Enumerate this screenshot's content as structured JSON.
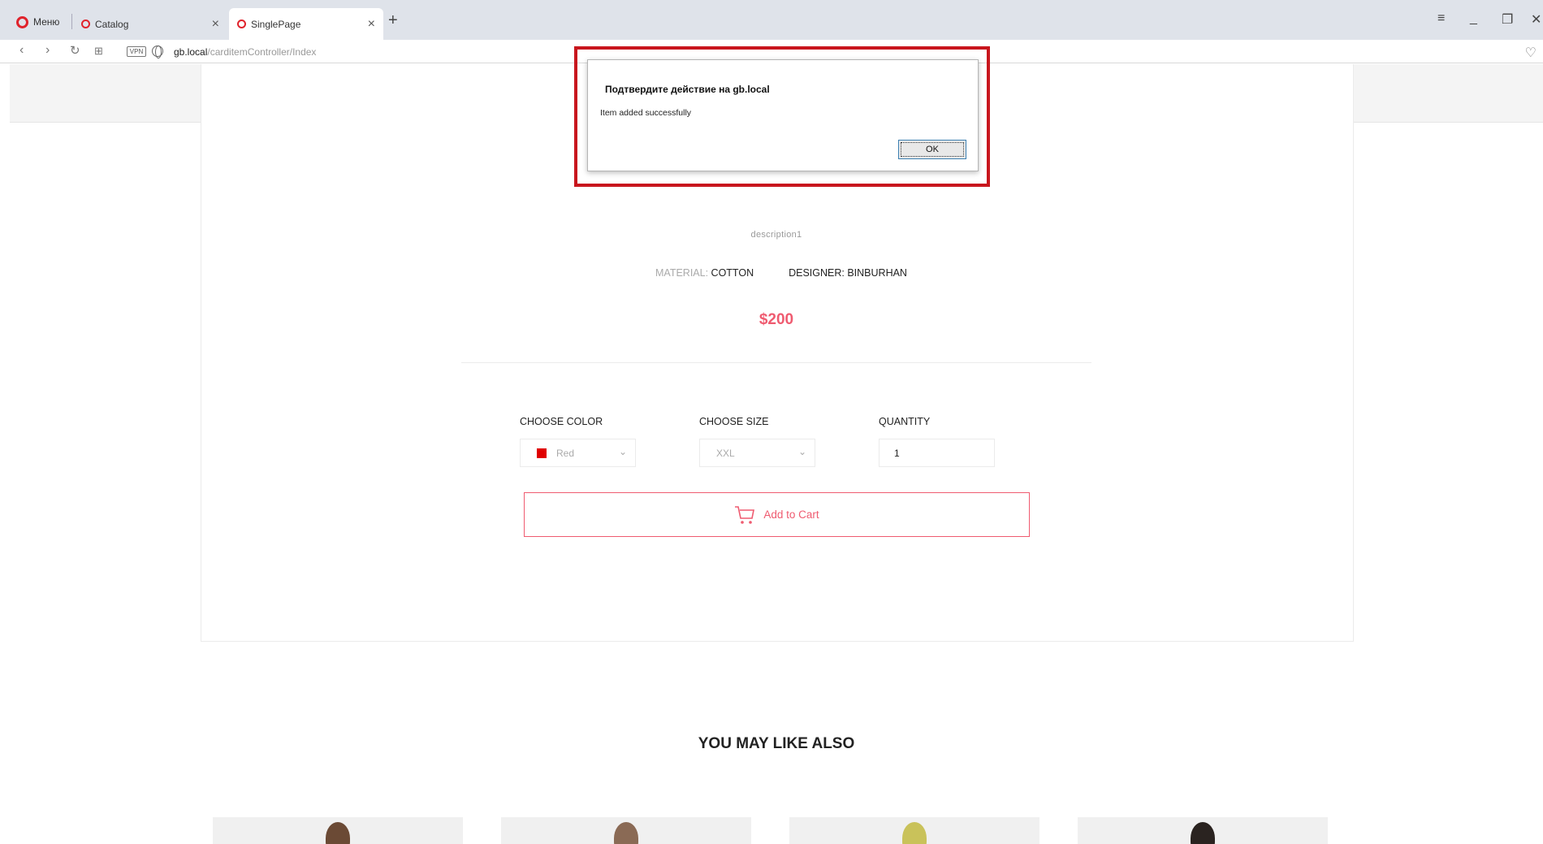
{
  "browser": {
    "menu_label": "Меню",
    "tabs": [
      {
        "title": "Catalog"
      },
      {
        "title": "SinglePage"
      }
    ],
    "url_host": "gb.local",
    "url_path": "/carditemController/Index",
    "vpn_label": "VPN"
  },
  "product": {
    "description": "description1",
    "material_label": "MATERIAL:",
    "material_value": "COTTON",
    "designer_label": "DESIGNER:",
    "designer_value": "BINBURHAN",
    "price": "$200",
    "color_label": "CHOOSE COLOR",
    "color_value": "Red",
    "swatch_color": "#e00000",
    "size_label": "CHOOSE SIZE",
    "size_value": "XXL",
    "quantity_label": "QUANTITY",
    "quantity_value": "1",
    "add_to_cart": "Add to Cart",
    "accent_color": "#ef5b70"
  },
  "related": {
    "title": "YOU MAY LIKE ALSO"
  },
  "dialog": {
    "title": "Подтвердите действие на gb.local",
    "message": "Item added successfully",
    "ok_label": "OK"
  }
}
